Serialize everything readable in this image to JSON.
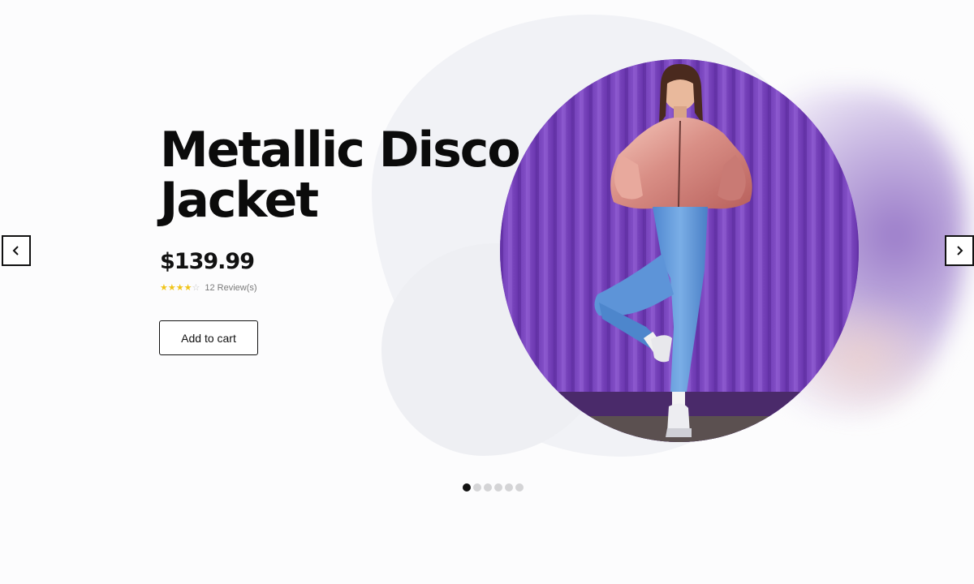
{
  "product": {
    "title_line1": "Metallic Disco",
    "title_line2": "Jacket",
    "price": "$139.99",
    "rating": 4,
    "rating_max": 5,
    "reviews_label": "12 Review(s)",
    "add_to_cart_label": "Add to cart"
  },
  "slider": {
    "prev_icon": "chevron-left-icon",
    "next_icon": "chevron-right-icon",
    "slide_count": 6,
    "active_slide": 1
  },
  "colors": {
    "star": "#f0c419",
    "photo_background": "#7a44c0",
    "accent_glow": "#9a7bc9"
  }
}
